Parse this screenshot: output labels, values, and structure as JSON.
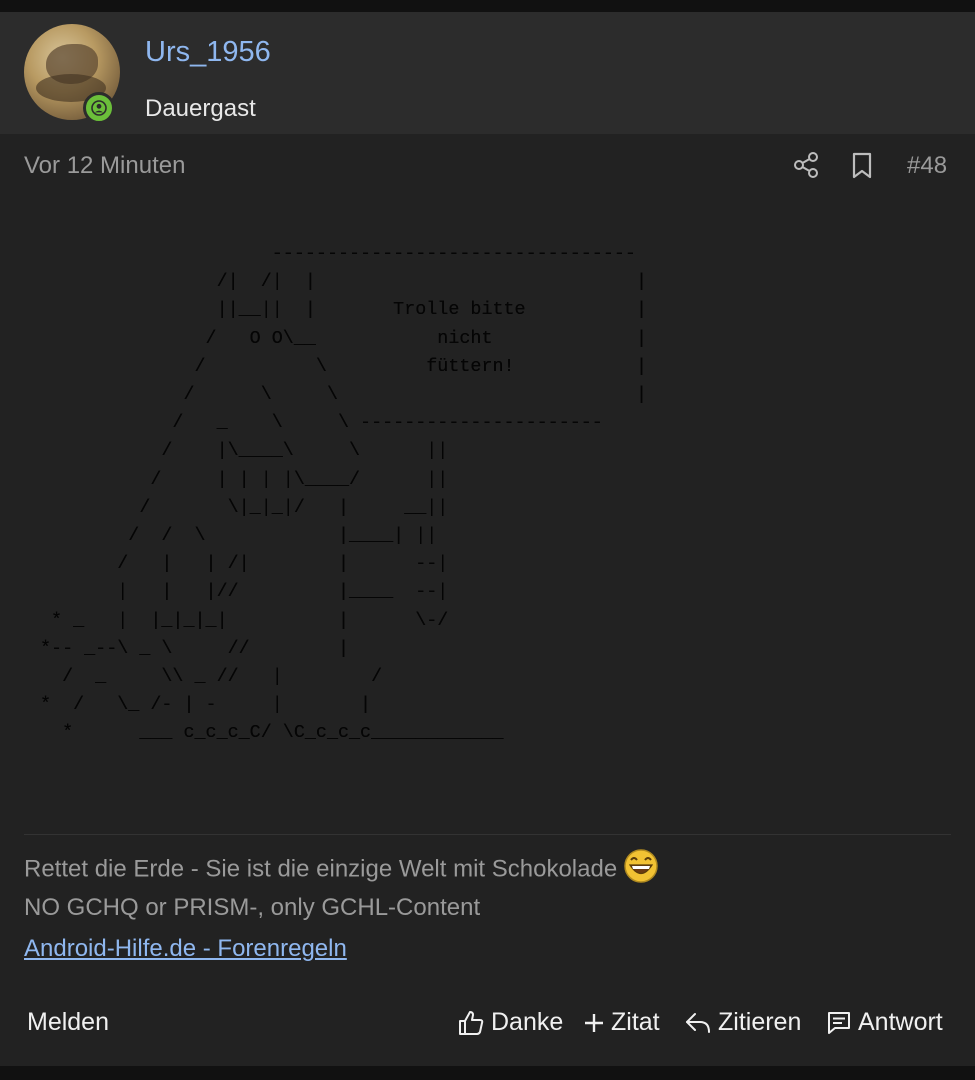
{
  "post": {
    "author": {
      "username": "Urs_1956",
      "rank": "Dauergast",
      "online": true
    },
    "time": "Vor 12 Minuten",
    "number": "#48",
    "ascii_art": "                     ---------------------------------\n                /|  /|  |                             |\n                ||__||  |       Trolle bitte          |\n               /   O O\\__           nicht             |\n              /          \\         füttern!           |\n             /      \\     \\                           |\n            /   _    \\     \\ ----------------------\n           /    |\\____\\     \\      ||\n          /     | | | |\\____/      ||\n         /       \\|_|_|/   |     __||\n        /  /  \\            |____| ||\n       /   |   | /|        |      --|\n       |   |   |//         |____  --|\n * _   |  |_|_|_|          |      \\-/\n*-- _--\\ _ \\     //        |\n  /  _     \\\\ _ //   |        /\n*  /   \\_ /- | -     |       |\n  *      ___ c_c_c_C/ \\C_c_c_c____________",
    "signature": {
      "line1": "Rettet die Erde - Sie ist die einzige Welt mit Schokolade",
      "line2": "NO GCHQ or PRISM-, only GCHL-Content",
      "link": "Android-Hilfe.de - Forenregeln",
      "emoji": "grinning-smiley"
    },
    "actions": {
      "report": "Melden",
      "like": "Danke",
      "multiquote": "Zitat",
      "quote": "Zitieren",
      "reply": "Antwort"
    }
  },
  "colors": {
    "background": "#222222",
    "header_bg": "#2c2c2c",
    "link": "#8fb7ef",
    "muted": "#9a9a9a",
    "online": "#6bbf3a"
  },
  "icons": [
    "share-icon",
    "bookmark-icon",
    "thumbs-up-icon",
    "plus-icon",
    "reply-arrow-icon",
    "comment-icon",
    "user-icon"
  ]
}
